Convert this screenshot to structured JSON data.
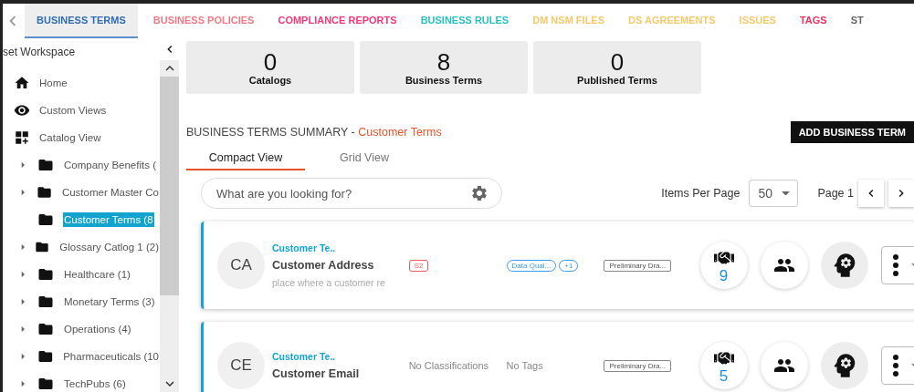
{
  "tabs": [
    {
      "label": "BUSINESS TERMS",
      "selected": true,
      "color": "#2f6db5"
    },
    {
      "label": "BUSINESS POLICIES",
      "selected": false,
      "color": "#ef7a85"
    },
    {
      "label": "COMPLIANCE REPORTS",
      "selected": false,
      "color": "#f0387a"
    },
    {
      "label": "BUSINESS RULES",
      "selected": false,
      "color": "#2bbfc0"
    },
    {
      "label": "DM NSM FILES",
      "selected": false,
      "color": "#f6c96a"
    },
    {
      "label": "DS AGREEMENTS",
      "selected": false,
      "color": "#f6c96a"
    },
    {
      "label": "ISSUES",
      "selected": false,
      "color": "#f6c96a"
    },
    {
      "label": "TAGS",
      "selected": false,
      "color": "#e8335f"
    },
    {
      "label": "ST",
      "selected": false,
      "color": "#666666"
    }
  ],
  "sidebar": {
    "title": "set Workspace",
    "items": [
      {
        "kind": "home",
        "label": "Home"
      },
      {
        "kind": "views",
        "label": "Custom Views"
      },
      {
        "kind": "catalog",
        "label": "Catalog View",
        "children": [
          {
            "label": "Company Benefits (",
            "expandable": true,
            "selected": false
          },
          {
            "label": "Customer Master Co",
            "expandable": true,
            "selected": false
          },
          {
            "label": "Customer Terms (8",
            "expandable": false,
            "selected": true
          },
          {
            "label": "Glossary Catlog 1 (2)",
            "expandable": true,
            "selected": false
          },
          {
            "label": "Healthcare (1)",
            "expandable": true,
            "selected": false
          },
          {
            "label": "Monetary Terms (3)",
            "expandable": true,
            "selected": false
          },
          {
            "label": "Operations (4)",
            "expandable": true,
            "selected": false
          },
          {
            "label": "Pharmaceuticals (10",
            "expandable": true,
            "selected": false
          },
          {
            "label": "TechPubs (6)",
            "expandable": true,
            "selected": false
          }
        ]
      }
    ]
  },
  "stats": [
    {
      "value": "0",
      "label": "Catalogs"
    },
    {
      "value": "8",
      "label": "Business Terms"
    },
    {
      "value": "0",
      "label": "Published Terms"
    }
  ],
  "summary": {
    "title": "BUSINESS TERMS SUMMARY - ",
    "catalog": "Customer Terms",
    "add_button": "ADD BUSINESS TERM"
  },
  "view_tabs": [
    {
      "label": "Compact View",
      "selected": true
    },
    {
      "label": "Grid View",
      "selected": false
    }
  ],
  "search": {
    "placeholder": "What are you looking for?"
  },
  "pagination": {
    "items_label": "Items Per Page",
    "per_page": "50",
    "page": "Page 1"
  },
  "terms": [
    {
      "initials": "CA",
      "catalog": "Customer Te..",
      "name": "Customer Address",
      "description": "place where a customer re",
      "classifications": {
        "kind": "chips",
        "items": [
          "S2"
        ]
      },
      "tags": {
        "kind": "chips",
        "items": [
          "Data Qual...",
          "+1"
        ]
      },
      "status": "Preliminary Dra...",
      "count": "9"
    },
    {
      "initials": "CE",
      "catalog": "Customer Te..",
      "name": "Customer Email",
      "classifications": {
        "kind": "text",
        "text": "No Classifications"
      },
      "tags": {
        "kind": "text",
        "text": "No Tags"
      },
      "status": "Preliminary Dra...",
      "count": "5"
    }
  ]
}
